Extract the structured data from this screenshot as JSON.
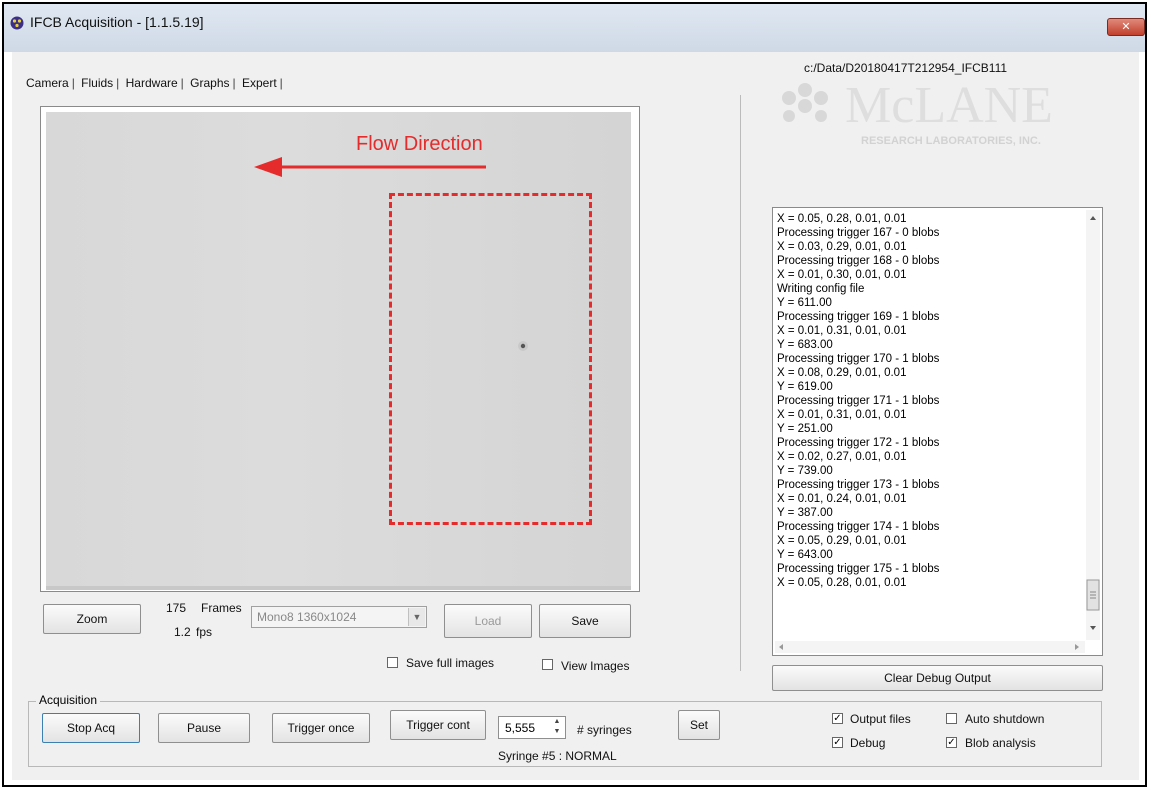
{
  "window": {
    "title": "IFCB Acquisition - [1.1.5.19]",
    "close_label": "✕"
  },
  "tabs": [
    {
      "label": "Camera"
    },
    {
      "label": "Fluids"
    },
    {
      "label": "Hardware"
    },
    {
      "label": "Graphs"
    },
    {
      "label": "Expert"
    }
  ],
  "camera": {
    "annotation": "Flow Direction",
    "frames_count": "175",
    "frames_label": "Frames",
    "fps_value": "1.2",
    "fps_label": "fps",
    "format_selected": "Mono8 1360x1024",
    "zoom_label": "Zoom",
    "load_label": "Load",
    "save_label": "Save",
    "save_full_images_label": "Save full images",
    "save_full_images_checked": false,
    "view_images_label": "View Images",
    "view_images_checked": false
  },
  "colors": {
    "annotation": "#e52b2b"
  },
  "right": {
    "data_path": "c:/Data/D20180417T212954_IFCB111",
    "logo": {
      "main": "McLANE",
      "sub": "RESEARCH LABORATORIES, INC."
    },
    "debug_lines": [
      "X = 0.05, 0.28, 0.01, 0.01",
      "Processing trigger 167 - 0 blobs",
      "X = 0.03, 0.29, 0.01, 0.01",
      "Processing trigger 168 - 0 blobs",
      "X = 0.01, 0.30, 0.01, 0.01",
      "Writing config file",
      "Y = 611.00",
      "Processing trigger 169 - 1 blobs",
      "X = 0.01, 0.31, 0.01, 0.01",
      "Y = 683.00",
      "Processing trigger 170 - 1 blobs",
      "X = 0.08, 0.29, 0.01, 0.01",
      "Y = 619.00",
      "Processing trigger 171 - 1 blobs",
      "X = 0.01, 0.31, 0.01, 0.01",
      "Y = 251.00",
      "Processing trigger 172 - 1 blobs",
      "X = 0.02, 0.27, 0.01, 0.01",
      "Y = 739.00",
      "Processing trigger 173 - 1 blobs",
      "X = 0.01, 0.24, 0.01, 0.01",
      "Y = 387.00",
      "Processing trigger 174 - 1 blobs",
      "X = 0.05, 0.29, 0.01, 0.01",
      "Y = 643.00",
      "Processing trigger 175 - 1 blobs",
      "X = 0.05, 0.28, 0.01, 0.01"
    ],
    "clear_label": "Clear Debug Output"
  },
  "acquisition": {
    "group_label": "Acquisition",
    "stop_label": "Stop Acq",
    "pause_label": "Pause",
    "trigger_once_label": "Trigger once",
    "trigger_cont_label": "Trigger cont",
    "syringes_value": "5,555",
    "syringes_label": "# syringes",
    "set_label": "Set",
    "status": "Syringe #5 : NORMAL",
    "output_files_label": "Output files",
    "output_files_checked": true,
    "auto_shutdown_label": "Auto shutdown",
    "auto_shutdown_checked": false,
    "debug_label": "Debug",
    "debug_checked": true,
    "blob_analysis_label": "Blob analysis",
    "blob_analysis_checked": true
  }
}
